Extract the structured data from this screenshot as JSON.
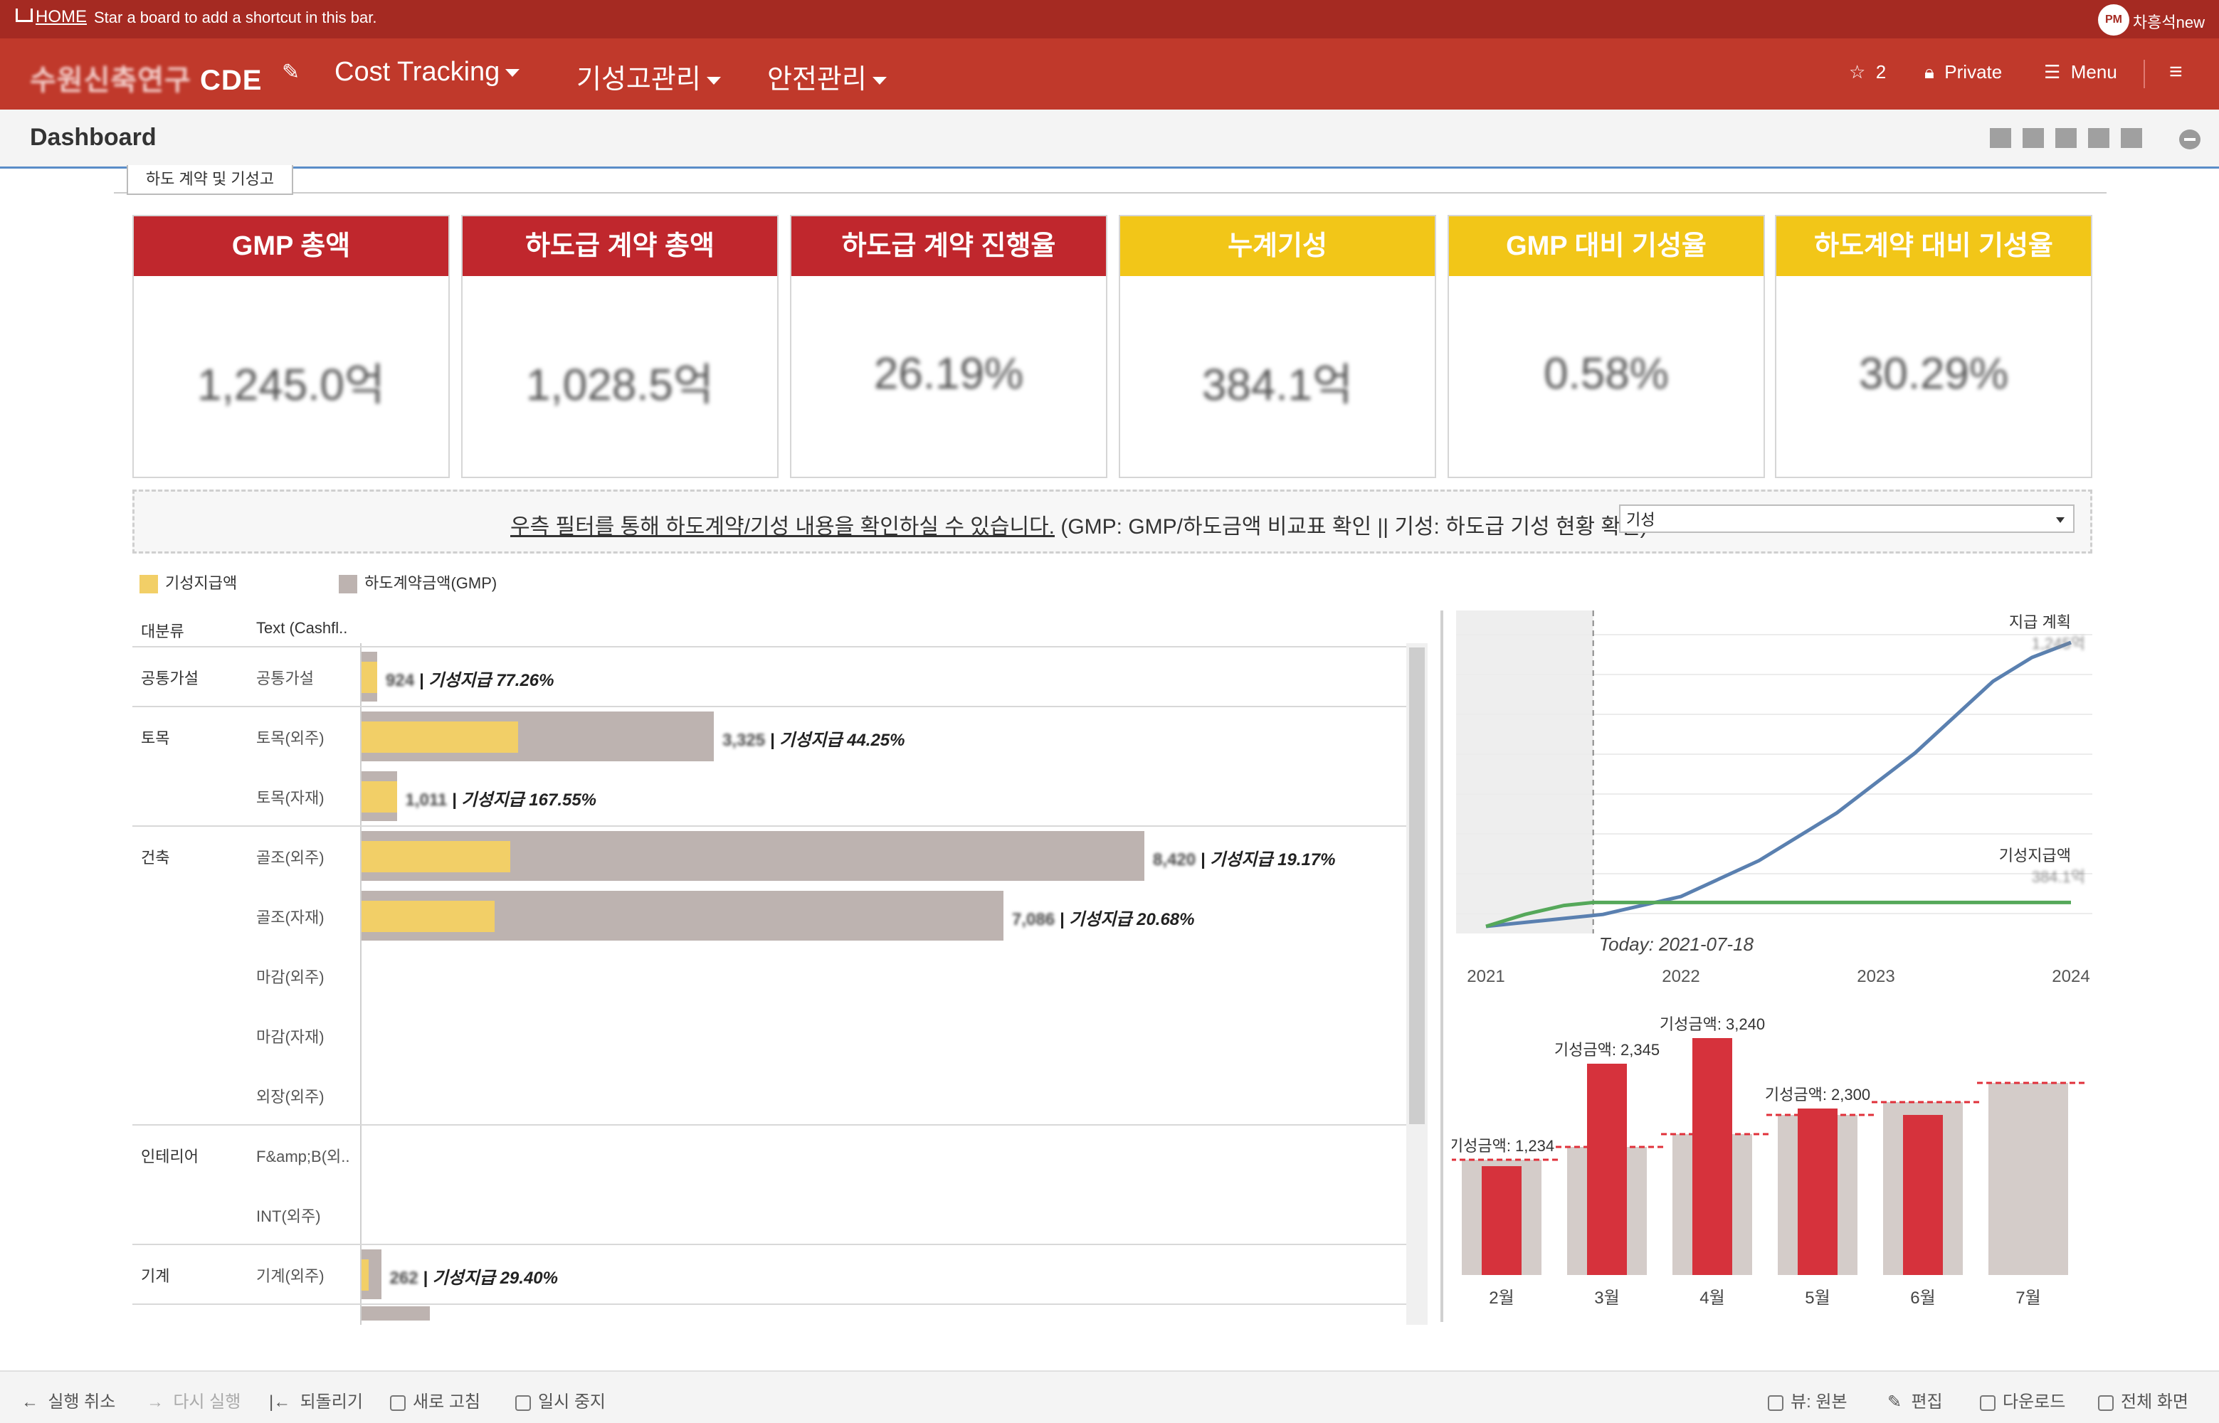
{
  "topbar": {
    "home": "HOME",
    "hint": "Star a board to add a shortcut in this bar.",
    "avatar": "PM",
    "user": "차흥석new"
  },
  "nav": {
    "logo_blur": "수원신축연구",
    "logo_text": "CDE",
    "items": [
      "Cost Tracking",
      "기성고관리",
      "안전관리"
    ],
    "star_count": "2",
    "private_label": "Private",
    "menu_label": "Menu"
  },
  "dashboard": {
    "title": "Dashboard",
    "tab": "하도 계약 및 기성고"
  },
  "kpis": [
    {
      "title": "GMP 총액",
      "value": "1,245.0억",
      "color": "red"
    },
    {
      "title": "하도급 계약 총액",
      "value": "1,028.5억",
      "color": "red"
    },
    {
      "title": "하도급 계약 진행율",
      "value": "26.19%",
      "color": "red"
    },
    {
      "title": "누계기성",
      "value": "384.1억",
      "color": "yellow"
    },
    {
      "title": "GMP 대비 기성율",
      "value": "0.58%",
      "color": "yellow"
    },
    {
      "title": "하도계약 대비 기성율",
      "value": "30.29%",
      "color": "yellow"
    }
  ],
  "filter": {
    "message_underlined": "우측 필터를 통해 하도계약/기성 내용을 확인하실 수 있습니다.",
    "message_rest": " (GMP: GMP/하도금액 비교표 확인  ||  기성: 하도급 기성 현황 확인)",
    "selected": "기성"
  },
  "legend": {
    "paid": "기성지급액",
    "contract": "하도계약금액(GMP)",
    "paid_color": "#f2cf67",
    "contract_color": "#bdb3b0"
  },
  "table": {
    "col_category": "대분류",
    "col_text": "Text (Cashfl..",
    "rows": [
      {
        "cat": "공통가설",
        "sub": "공통가설",
        "num": "924",
        "pct": "기성지급 77.26%"
      },
      {
        "cat": "토목",
        "sub": "토목(외주)",
        "num": "3,325",
        "pct": "기성지급 44.25%"
      },
      {
        "cat": "",
        "sub": "토목(자재)",
        "num": "1,011",
        "pct": "기성지급 167.55%"
      },
      {
        "cat": "건축",
        "sub": "골조(외주)",
        "num": "8,420",
        "pct": "기성지급 19.17%"
      },
      {
        "cat": "",
        "sub": "골조(자재)",
        "num": "7,086",
        "pct": "기성지급 20.68%"
      },
      {
        "cat": "",
        "sub": "마감(외주)",
        "num": "",
        "pct": ""
      },
      {
        "cat": "",
        "sub": "마감(자재)",
        "num": "",
        "pct": ""
      },
      {
        "cat": "",
        "sub": "외장(외주)",
        "num": "",
        "pct": ""
      },
      {
        "cat": "인테리어",
        "sub": "F&amp;B(외..",
        "num": "",
        "pct": ""
      },
      {
        "cat": "",
        "sub": "INT(외주)",
        "num": "",
        "pct": ""
      },
      {
        "cat": "기계",
        "sub": "기계(외주)",
        "num": "262",
        "pct": "기성지급 29.40%"
      }
    ],
    "bar_values": {
      "note": "contract (grey) and paid (yellow) as fraction of max axis",
      "grey": [
        0.02,
        0.45,
        0.045,
        1.0,
        0.82,
        0,
        0,
        0,
        0,
        0,
        0.025
      ],
      "yellow": [
        0.02,
        0.2,
        0.045,
        0.19,
        0.17,
        0,
        0,
        0,
        0,
        0,
        0.008
      ]
    }
  },
  "chart_data": [
    {
      "type": "line",
      "x_ticks": [
        "2021",
        "2022",
        "2023",
        "2024"
      ],
      "today_label": "Today: 2021-07-18",
      "series": [
        {
          "name": "지급 계획",
          "value_label": "1,245억",
          "color": "#5a80b0",
          "x": [
            2021.0,
            2021.3,
            2021.6,
            2022.0,
            2022.4,
            2022.8,
            2023.2,
            2023.6,
            2023.8,
            2024.0
          ],
          "y": [
            0,
            2,
            4,
            10,
            22,
            38,
            58,
            82,
            90,
            95
          ]
        },
        {
          "name": "기성지급액",
          "value_label": "384.1억",
          "color": "#55a85a",
          "x": [
            2021.0,
            2021.2,
            2021.4,
            2021.55,
            2024.0
          ],
          "y": [
            0,
            4,
            7,
            8,
            8
          ]
        }
      ]
    },
    {
      "type": "bar",
      "categories": [
        "2월",
        "3월",
        "4월",
        "5월",
        "6월",
        "7월"
      ],
      "series": [
        {
          "name": "계획",
          "color": "#d4ccc9",
          "values": [
            36,
            40,
            44,
            50,
            54,
            60
          ]
        },
        {
          "name": "기성금액",
          "color": "#d6323c",
          "values": [
            34,
            66,
            74,
            52,
            50,
            0
          ]
        }
      ],
      "data_labels": [
        "기성금액: 1,234",
        "기성금액: 2,345",
        "기성금액: 3,240",
        "기성금액: 2,300",
        "",
        ""
      ],
      "ylim": [
        0,
        80
      ]
    }
  ],
  "bottombar": {
    "undo": "실행 취소",
    "redo": "다시 실행",
    "revert": "되돌리기",
    "refresh": "새로 고침",
    "pause": "일시 중지",
    "view": "뷰: 원본",
    "edit": "편집",
    "download": "다운로드",
    "fullscreen": "전체 화면"
  }
}
